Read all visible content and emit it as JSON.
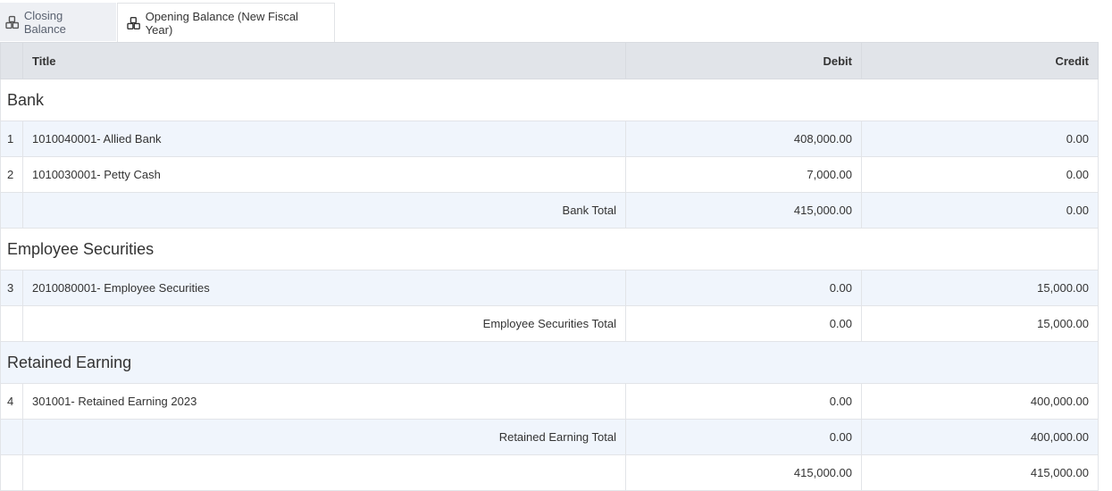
{
  "tabs": [
    {
      "label": "Closing Balance",
      "icon": "cubes-icon",
      "active": false
    },
    {
      "label": "Opening Balance (New Fiscal Year)",
      "icon": "cubes-icon",
      "active": true
    }
  ],
  "table": {
    "headers": {
      "num": "",
      "title": "Title",
      "debit": "Debit",
      "credit": "Credit"
    },
    "groups": [
      {
        "name": "Bank",
        "rows": [
          {
            "num": "1",
            "title": "1010040001- Allied Bank",
            "debit": "408,000.00",
            "credit": "0.00"
          },
          {
            "num": "2",
            "title": "1010030001- Petty Cash",
            "debit": "7,000.00",
            "credit": "0.00"
          }
        ],
        "total": {
          "label": "Bank Total",
          "debit": "415,000.00",
          "credit": "0.00"
        }
      },
      {
        "name": "Employee Securities",
        "rows": [
          {
            "num": "3",
            "title": "2010080001- Employee Securities",
            "debit": "0.00",
            "credit": "15,000.00"
          }
        ],
        "total": {
          "label": "Employee Securities Total",
          "debit": "0.00",
          "credit": "15,000.00"
        }
      },
      {
        "name": "Retained Earning",
        "rows": [
          {
            "num": "4",
            "title": "301001- Retained Earning 2023",
            "debit": "0.00",
            "credit": "400,000.00"
          }
        ],
        "total": {
          "label": "Retained Earning Total",
          "debit": "0.00",
          "credit": "400,000.00"
        }
      }
    ],
    "grand_total": {
      "debit": "415,000.00",
      "credit": "415,000.00"
    }
  }
}
